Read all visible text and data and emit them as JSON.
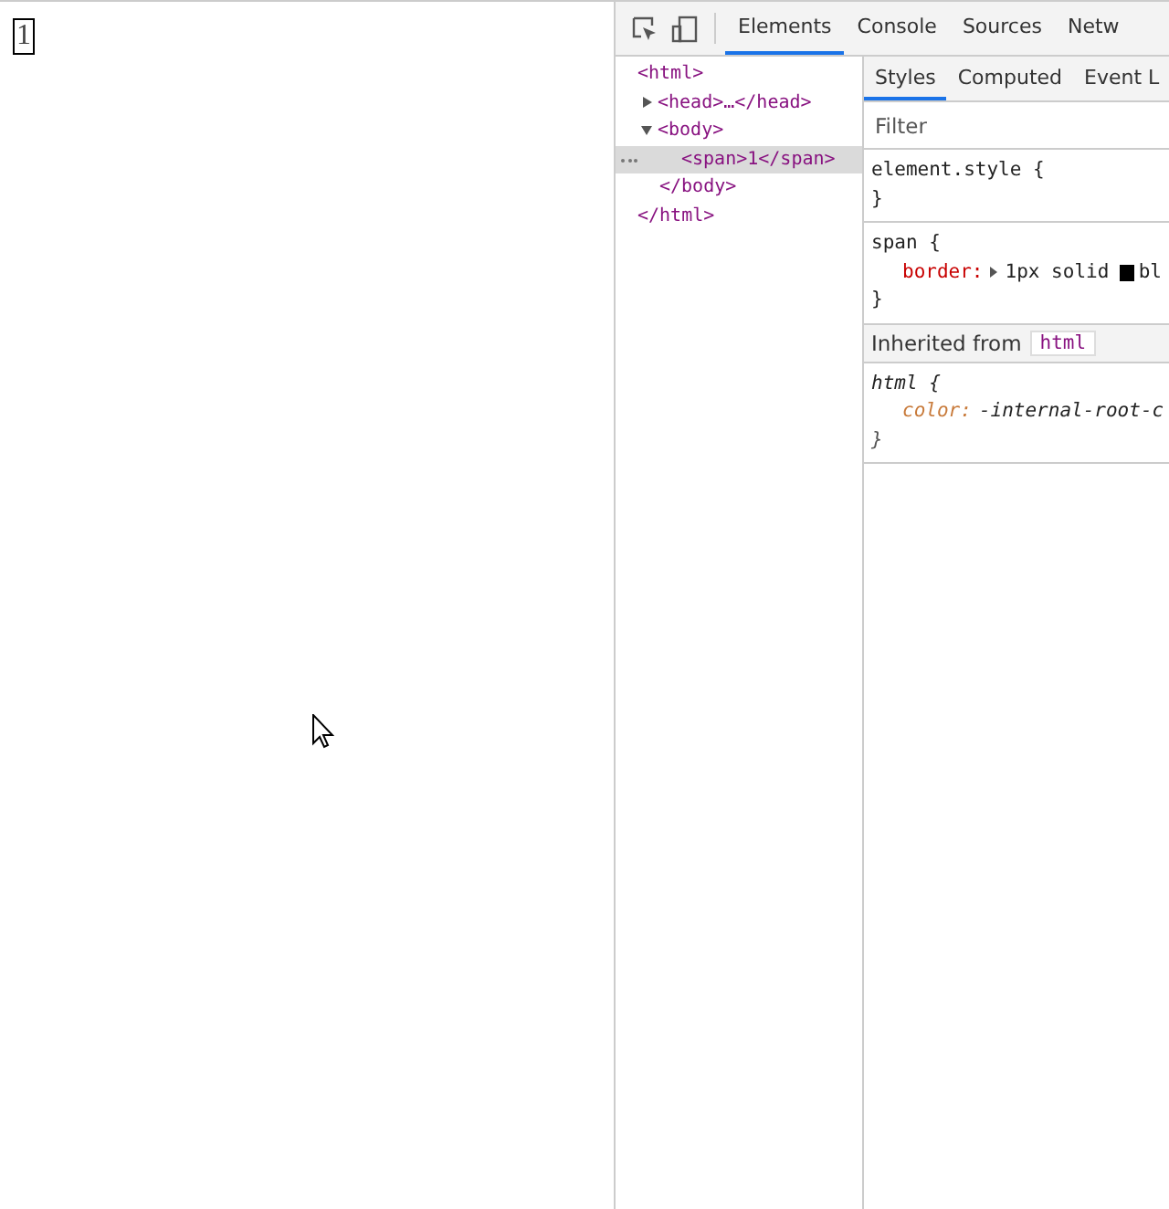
{
  "page": {
    "span_text": "1"
  },
  "devtools": {
    "tabs": [
      {
        "label": "Elements",
        "selected": true
      },
      {
        "label": "Console",
        "selected": false
      },
      {
        "label": "Sources",
        "selected": false
      },
      {
        "label": "Netw",
        "selected": false
      }
    ],
    "dom_tree": [
      {
        "open": "<html>",
        "close": "</html>",
        "selected": false,
        "children": [
          {
            "open": "<head>…</head>",
            "expanded": false,
            "selected": false
          },
          {
            "open": "<body>",
            "close": "</body>",
            "expanded": true,
            "selected": false,
            "children": [
              {
                "open": "<span>1</span>",
                "selected": true
              }
            ]
          }
        ]
      }
    ],
    "styles_tabs": [
      {
        "label": "Styles",
        "selected": true
      },
      {
        "label": "Computed",
        "selected": false
      },
      {
        "label": "Event L",
        "selected": false
      }
    ],
    "filter": {
      "placeholder": "Filter"
    },
    "rules": [
      {
        "kind": "matched",
        "selector": "element.style {",
        "close": "}"
      },
      {
        "kind": "matched",
        "selector": "span {",
        "close": "}",
        "declarations": [
          {
            "name": "border:",
            "value": "1px solid",
            "value_rest": "bl"
          }
        ]
      },
      {
        "kind": "inherited_header",
        "label": "Inherited from",
        "tag": "html"
      },
      {
        "kind": "inherited",
        "selector": "html {",
        "close": "}",
        "declarations": [
          {
            "name": "color:",
            "value": "-internal-root-c"
          }
        ]
      }
    ]
  }
}
